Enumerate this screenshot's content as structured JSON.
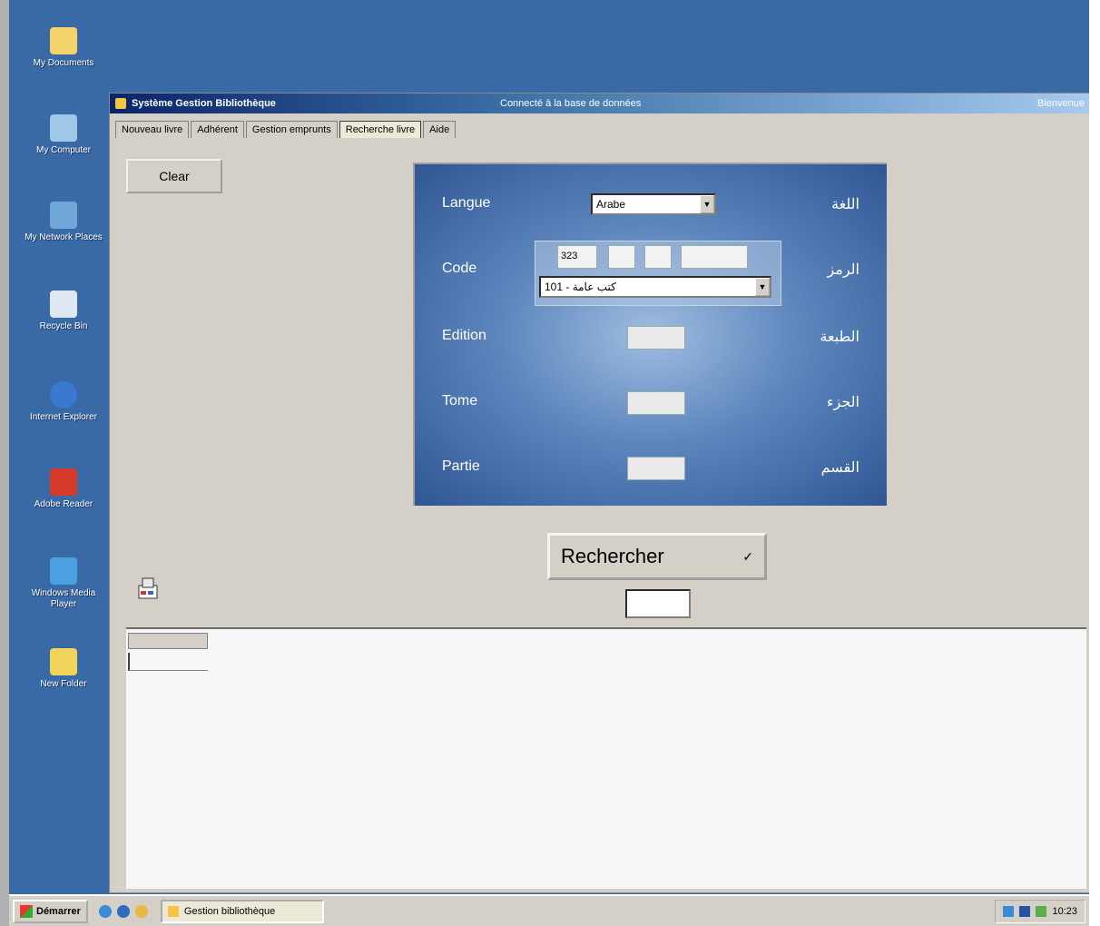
{
  "desktop": {
    "icons": [
      {
        "label": "My Documents",
        "name": "my-documents-icon",
        "color": "#f3d36a"
      },
      {
        "label": "My Computer",
        "name": "my-computer-icon",
        "color": "#9ec7e8"
      },
      {
        "label": "My Network Places",
        "name": "network-places-icon",
        "color": "#6fa8d8"
      },
      {
        "label": "Recycle Bin",
        "name": "recycle-bin-icon",
        "color": "#dfe8f2"
      },
      {
        "label": "Internet Explorer",
        "name": "internet-explorer-icon",
        "color": "#3b78d0"
      },
      {
        "label": "Adobe Reader",
        "name": "adobe-reader-icon",
        "color": "#d63a2a"
      },
      {
        "label": "Windows Media Player",
        "name": "media-player-icon",
        "color": "#4aa0e0"
      },
      {
        "label": "New Folder",
        "name": "folder-icon",
        "color": "#f0d55a"
      }
    ]
  },
  "window": {
    "title": "Système Gestion Bibliothèque",
    "title_center": "Connecté à la base de données",
    "title_right": "Bienvenue",
    "tabs": [
      "Nouveau livre",
      "Adhérent",
      "Gestion emprunts",
      "Recherche livre",
      "Aide"
    ],
    "active_tab_index": 3,
    "clear_label": "Clear"
  },
  "search_panel": {
    "langue_label": "Langue",
    "langue_ar": "اللغة",
    "langue_value": "Arabe",
    "code_label": "Code",
    "code_ar": "الرمز",
    "code_prefix": "323",
    "code_select_value": "101 - كتب عامة",
    "edition_label": "Edition",
    "edition_ar": "الطبعة",
    "tome_label": "Tome",
    "tome_ar": "الجزء",
    "partie_label": "Partie",
    "partie_ar": "القسم"
  },
  "actions": {
    "search_label": "Rechercher",
    "search_check": "✓"
  },
  "taskbar": {
    "start_label": "Démarrer",
    "task_label": "Gestion bibliothèque",
    "clock": "10:23"
  }
}
